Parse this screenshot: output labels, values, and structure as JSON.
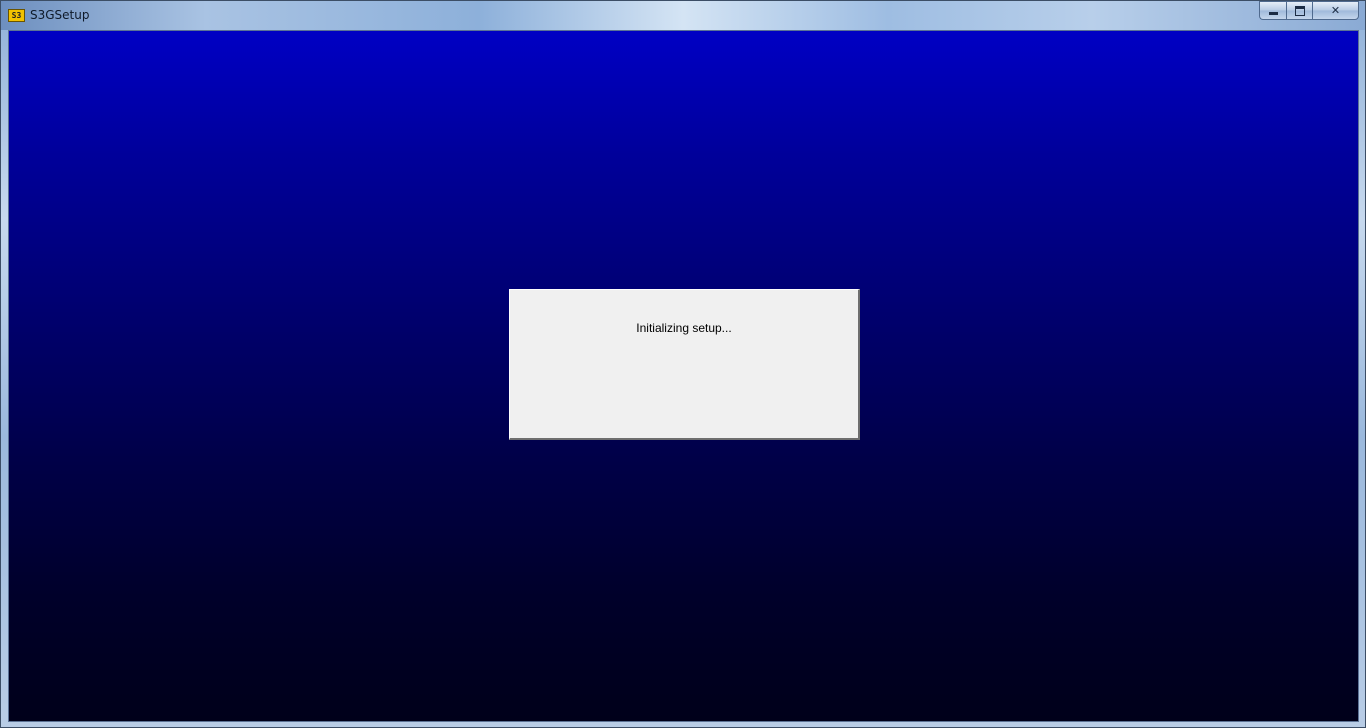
{
  "window": {
    "title": "S3GSetup",
    "icon": {
      "name": "s3-logo-icon",
      "text": "S3",
      "color": "#f2c200"
    },
    "controls": {
      "minimize": "minimize-icon",
      "maximize": "maximize-icon",
      "close_label": "✕"
    }
  },
  "dialog": {
    "status": "Initializing setup..."
  },
  "colors": {
    "background_top": "#0000c4",
    "background_bottom": "#00001a",
    "dialog_bg": "#f0f0f0"
  }
}
